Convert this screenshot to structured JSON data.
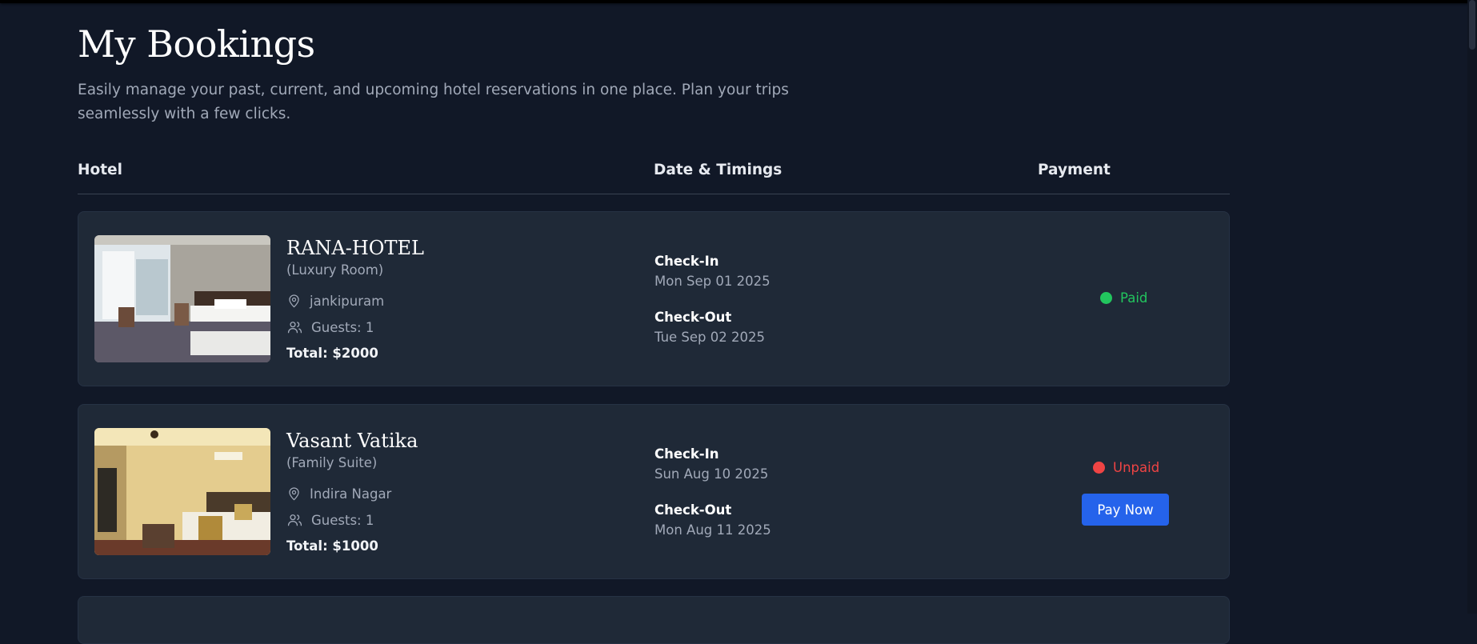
{
  "page": {
    "title": "My Bookings",
    "subtitle": "Easily manage your past, current, and upcoming hotel reservations in one place. Plan your trips seamlessly with a few clicks."
  },
  "table": {
    "headers": {
      "hotel": "Hotel",
      "dates": "Date & Timings",
      "payment": "Payment"
    }
  },
  "bookings": [
    {
      "hotel_name": "RANA-HOTEL",
      "room_type": "(Luxury Room)",
      "location": "jankipuram",
      "guests": "Guests: 1",
      "total": "Total: $2000",
      "checkin_label": "Check-In",
      "checkin_date": "Mon Sep 01 2025",
      "checkout_label": "Check-Out",
      "checkout_date": "Tue Sep 02 2025",
      "status": "Paid",
      "status_color": "#22c55e"
    },
    {
      "hotel_name": "Vasant Vatika",
      "room_type": "(Family Suite)",
      "location": "Indira Nagar",
      "guests": "Guests: 1",
      "total": "Total: $1000",
      "checkin_label": "Check-In",
      "checkin_date": "Sun Aug 10 2025",
      "checkout_label": "Check-Out",
      "checkout_date": "Mon Aug 11 2025",
      "status": "Unpaid",
      "status_color": "#ef4444",
      "pay_button_label": "Pay Now"
    }
  ],
  "colors": {
    "background": "#111827",
    "card": "#1f2937",
    "accent_blue": "#2563eb"
  },
  "icons": [
    "location-pin-icon",
    "guests-icon"
  ]
}
